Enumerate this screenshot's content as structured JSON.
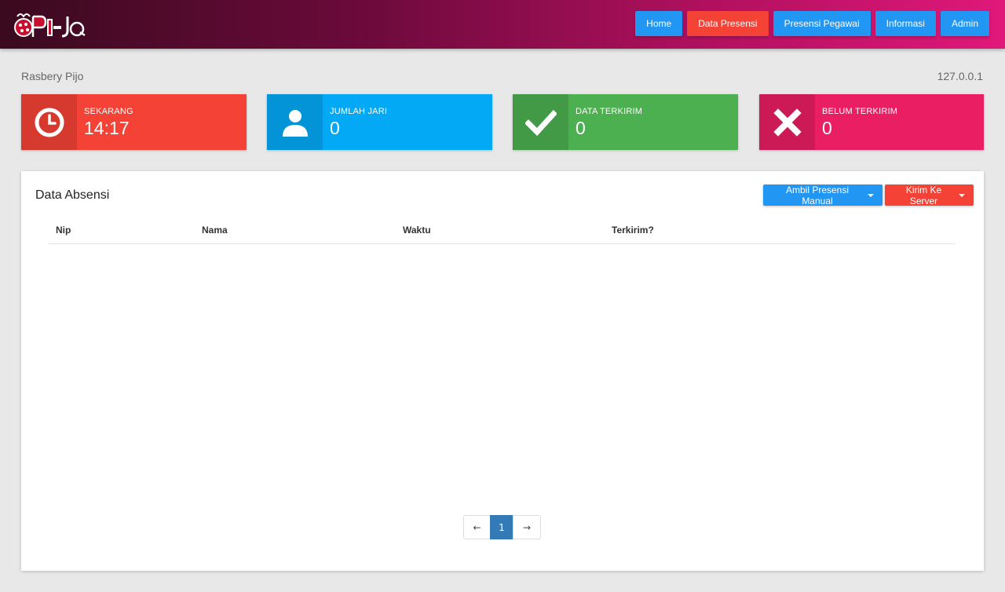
{
  "nav": {
    "items": [
      {
        "label": "Home"
      },
      {
        "label": "Data Presensi"
      },
      {
        "label": "Presensi Pegawai"
      },
      {
        "label": "Informasi"
      },
      {
        "label": "Admin"
      }
    ],
    "active_color": "#f44336",
    "default_color": "#2196f3"
  },
  "site": {
    "name": "Rasbery Pijo",
    "ip": "127.0.0.1"
  },
  "cards": [
    {
      "label": "SEKARANG",
      "value": "14:17",
      "icon": "clock-icon",
      "color": "#f44336"
    },
    {
      "label": "JUMLAH JARI",
      "value": "0",
      "icon": "user-icon",
      "color": "#03a9f4"
    },
    {
      "label": "DATA TERKIRIM",
      "value": "0",
      "icon": "check-icon",
      "color": "#4caf50"
    },
    {
      "label": "BELUM TERKIRIM",
      "value": "0",
      "icon": "cross-icon",
      "color": "#e91e63"
    }
  ],
  "panel": {
    "title": "Data Absensi",
    "manual_button": "Ambil Presensi Manual",
    "send_button": "Kirim Ke Server",
    "columns": [
      "Nip",
      "Nama",
      "Waktu",
      "Terkirim?"
    ],
    "rows": []
  },
  "pagination": {
    "prev": "←",
    "current": "1",
    "next": "→"
  }
}
